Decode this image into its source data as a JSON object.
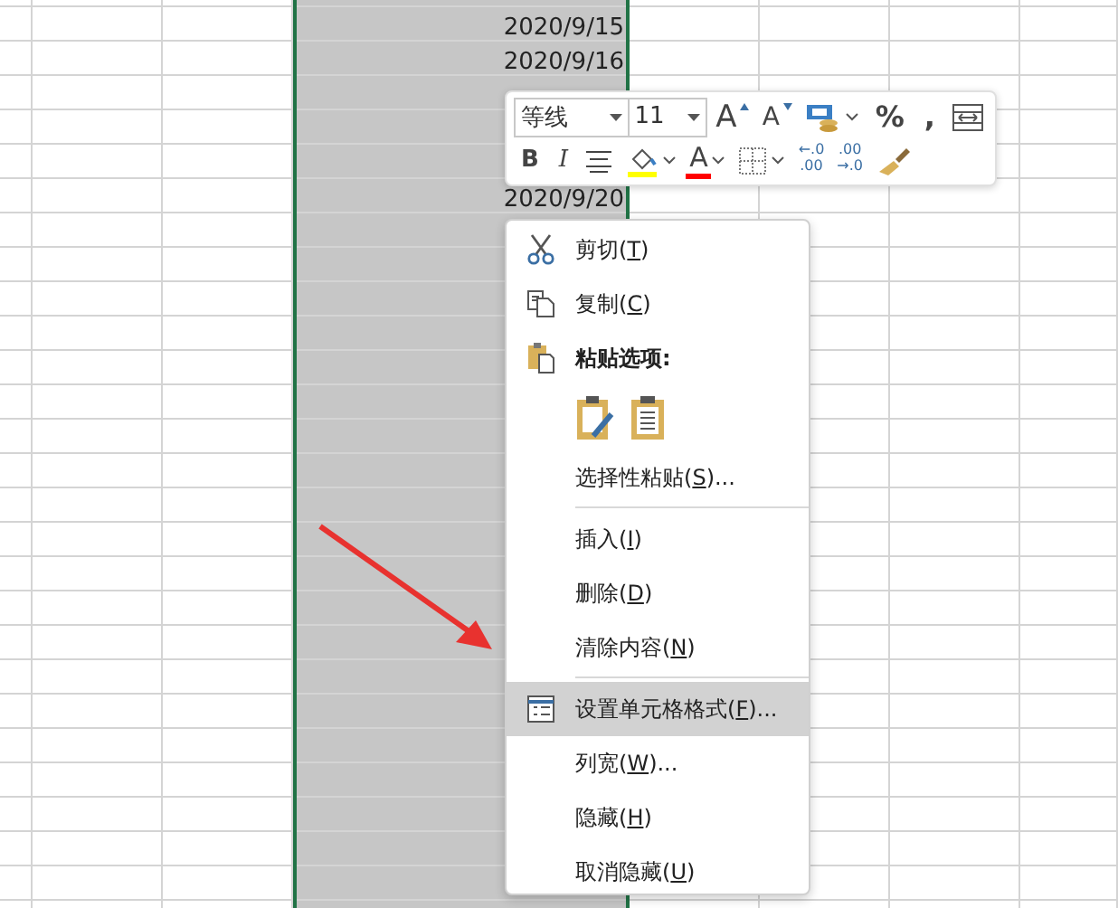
{
  "sheet": {
    "columns": [
      {
        "selected": false
      },
      {
        "selected": false
      },
      {
        "selected": false
      },
      {
        "selected": true
      },
      {
        "selected": false
      },
      {
        "selected": false
      },
      {
        "selected": false
      },
      {
        "selected": false
      }
    ],
    "rows": [
      {
        "cell": "2020/9/15"
      },
      {
        "cell": "2020/9/16"
      },
      {},
      {},
      {},
      {
        "cell": "2020/9/20"
      }
    ]
  },
  "mini_toolbar": {
    "font_row": [
      {
        "kind": "font",
        "value": "等线"
      },
      {
        "kind": "size",
        "value": "11"
      },
      {
        "kind": "grow",
        "label": "A"
      },
      {
        "kind": "shrink",
        "label": "A"
      },
      {
        "kind": "number-format",
        "dropdown": true
      },
      {
        "kind": "percent",
        "label": "%"
      },
      {
        "kind": "comma",
        "label": ","
      },
      {
        "kind": "wrap"
      }
    ],
    "format_row": [
      {
        "kind": "bold",
        "label": "B"
      },
      {
        "kind": "italic",
        "label": "I"
      },
      {
        "kind": "align"
      },
      {
        "kind": "fill",
        "dropdown": true,
        "color": "#ffff00"
      },
      {
        "kind": "font-color",
        "label": "A",
        "dropdown": true,
        "color": "#ff0000"
      },
      {
        "kind": "borders",
        "dropdown": true
      },
      {
        "kind": "increase-decimal",
        "top": "←.0",
        "bottom": ".00"
      },
      {
        "kind": "decrease-decimal",
        "top": ".00",
        "bottom": "→.0"
      },
      {
        "kind": "painter"
      }
    ]
  },
  "context_menu": {
    "items": [
      {
        "kind": "cut",
        "before": "剪切(",
        "key": "T",
        "after": ")",
        "selected": false
      },
      {
        "kind": "copy",
        "before": "复制(",
        "key": "C",
        "after": ")",
        "selected": false
      },
      {
        "kind": "header",
        "label": "粘贴选项:"
      },
      {
        "kind": "paste-options"
      },
      {
        "kind": "item",
        "before": "选择性粘贴(",
        "key": "S",
        "after": ")...",
        "selected": false
      },
      {
        "kind": "separator"
      },
      {
        "kind": "item",
        "before": "插入(",
        "key": "I",
        "after": ")",
        "selected": false
      },
      {
        "kind": "item",
        "before": "删除(",
        "key": "D",
        "after": ")",
        "selected": false
      },
      {
        "kind": "item",
        "before": "清除内容(",
        "key": "N",
        "after": ")",
        "selected": false
      },
      {
        "kind": "separator"
      },
      {
        "kind": "format",
        "before": "设置单元格格式(",
        "key": "F",
        "after": ")...",
        "selected": true
      },
      {
        "kind": "item",
        "before": "列宽(",
        "key": "W",
        "after": ")...",
        "selected": false
      },
      {
        "kind": "item",
        "before": "隐藏(",
        "key": "H",
        "after": ")",
        "selected": false
      },
      {
        "kind": "item",
        "before": "取消隐藏(",
        "key": "U",
        "after": ")",
        "selected": false
      }
    ]
  }
}
